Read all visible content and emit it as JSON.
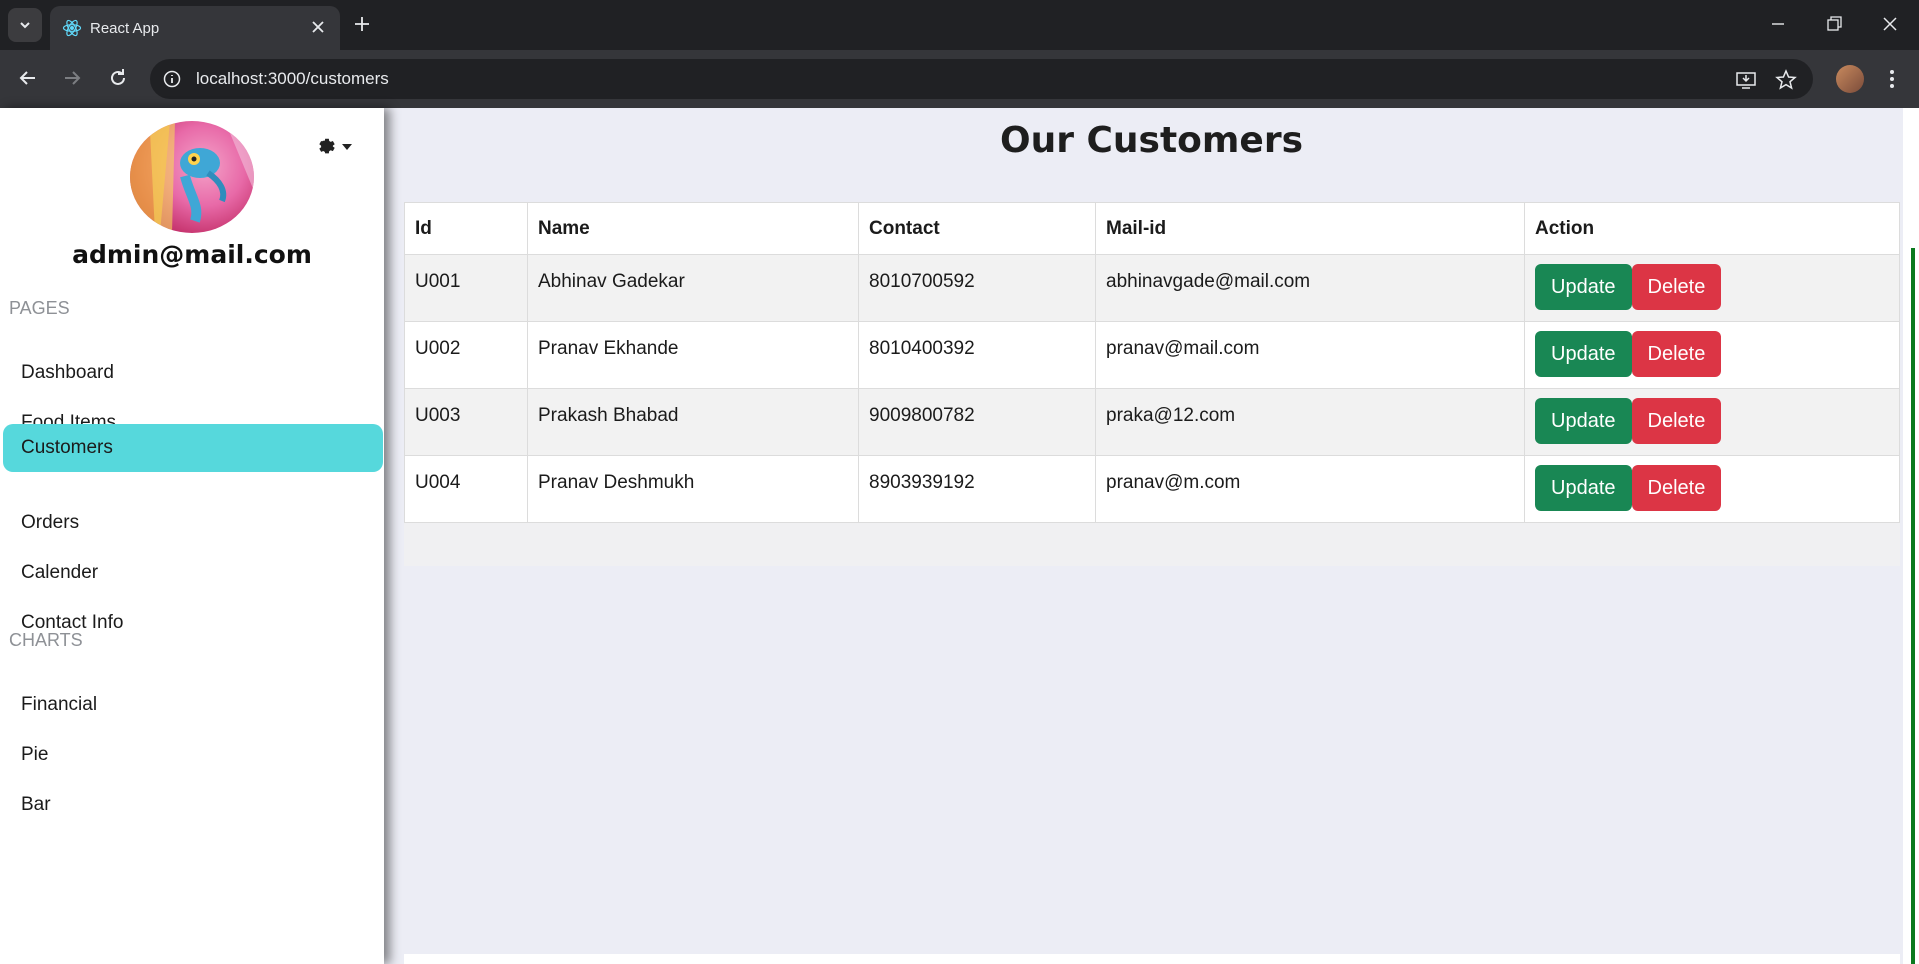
{
  "browser": {
    "tab_title": "React App",
    "url": "localhost:3000/customers"
  },
  "sidebar": {
    "email": "admin@mail.com",
    "sections": [
      {
        "label": "PAGES",
        "items": [
          "Dashboard",
          "Food Items",
          "Customers",
          "Orders",
          "Calender",
          "Contact Info"
        ]
      },
      {
        "label": "CHARTS",
        "items": [
          "Financial",
          "Pie",
          "Bar"
        ]
      }
    ],
    "active_item": "Customers"
  },
  "main": {
    "title": "Our Customers",
    "table": {
      "headers": [
        "Id",
        "Name",
        "Contact",
        "Mail-id",
        "Action"
      ],
      "rows": [
        {
          "id": "U001",
          "name": "Abhinav Gadekar",
          "contact": "8010700592",
          "mail": "abhinavgade@mail.com"
        },
        {
          "id": "U002",
          "name": "Pranav Ekhande",
          "contact": "8010400392",
          "mail": "pranav@mail.com"
        },
        {
          "id": "U003",
          "name": "Prakash Bhabad",
          "contact": "9009800782",
          "mail": "praka@12.com"
        },
        {
          "id": "U004",
          "name": "Pranav Deshmukh",
          "contact": "8903939192",
          "mail": "pranav@m.com"
        }
      ],
      "update_label": "Update",
      "delete_label": "Delete"
    }
  },
  "colors": {
    "active_nav": "#56d8dc",
    "update_button": "#198754",
    "delete_button": "#dc3545",
    "page_background": "#ecedf5"
  }
}
